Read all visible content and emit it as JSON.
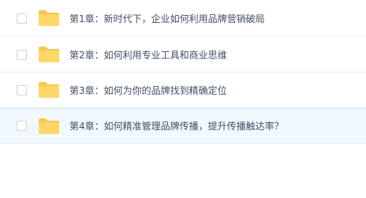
{
  "file_list": {
    "items": [
      {
        "name": "第1章：新时代下，企业如何利用品牌营销破局",
        "icon": "folder-icon",
        "selected": false
      },
      {
        "name": "第2章：如何利用专业工具和商业思维",
        "icon": "folder-icon",
        "selected": false
      },
      {
        "name": "第3章：如何为你的品牌找到精确定位",
        "icon": "folder-icon",
        "selected": false
      },
      {
        "name": "第4章：如何精准管理品牌传播，提升传播触达率？",
        "icon": "folder-icon",
        "selected": true
      }
    ]
  },
  "colors": {
    "folder": "#ffd767",
    "folder_tab": "#f5c84c",
    "selected_row_bg": "#f2f9fe",
    "text": "#424e67"
  }
}
